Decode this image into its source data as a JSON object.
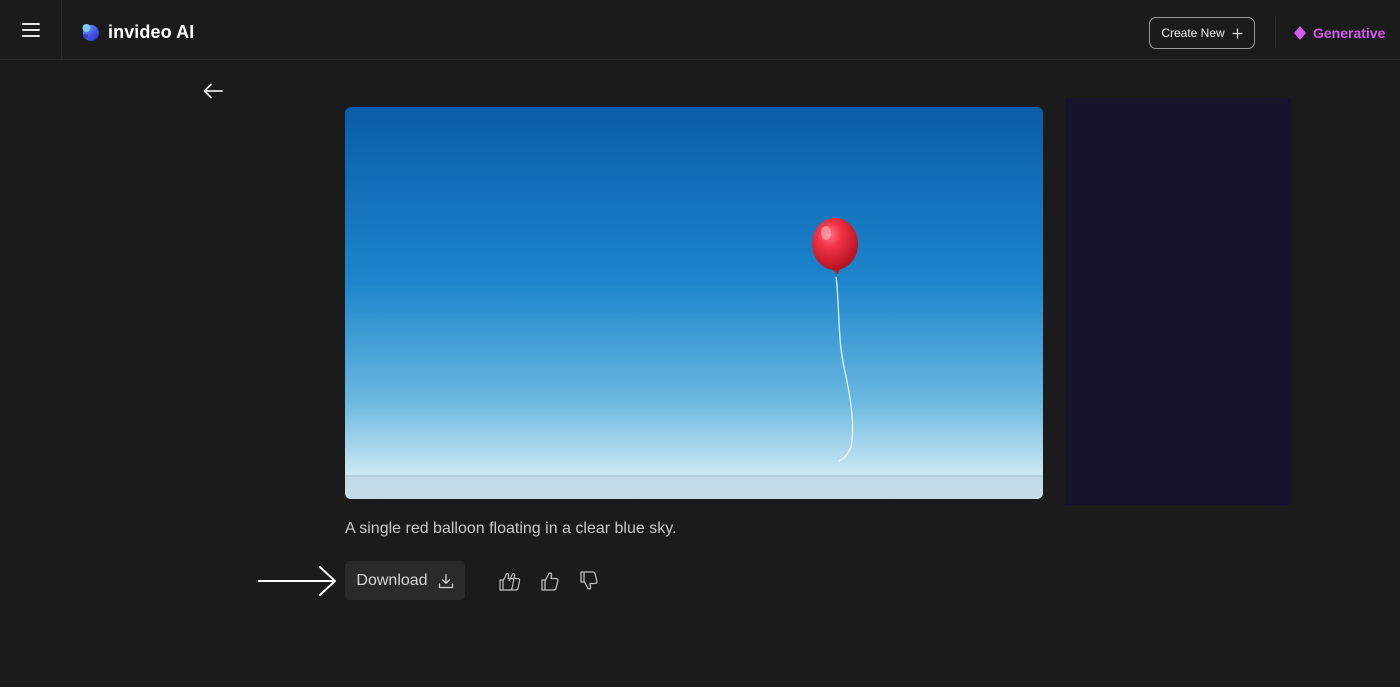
{
  "header": {
    "brand_name": "invideo AI",
    "create_button_label": "Create New",
    "plan_label": "Generative",
    "plan_color": "#d45bf0"
  },
  "icons": {
    "menu": "hamburger-menu-icon",
    "logo": "invideo-logo-icon",
    "create": "plus-icon",
    "plan": "diamond-icon",
    "back": "arrow-left-icon",
    "download": "download-icon",
    "feedback": [
      "double-thumbs-up-icon",
      "thumbs-up-icon",
      "thumbs-down-icon"
    ]
  },
  "main": {
    "image_alt": "A single red balloon floating in a clear blue sky.",
    "caption": "A single red balloon floating in a clear blue sky.",
    "download_label": "Download"
  },
  "colors": {
    "background": "#1b1b1b",
    "sky_top": "#0a5ca8",
    "sky_bottom": "#d8edf5",
    "balloon": "#e8223a",
    "side_panel": "#15142a"
  }
}
